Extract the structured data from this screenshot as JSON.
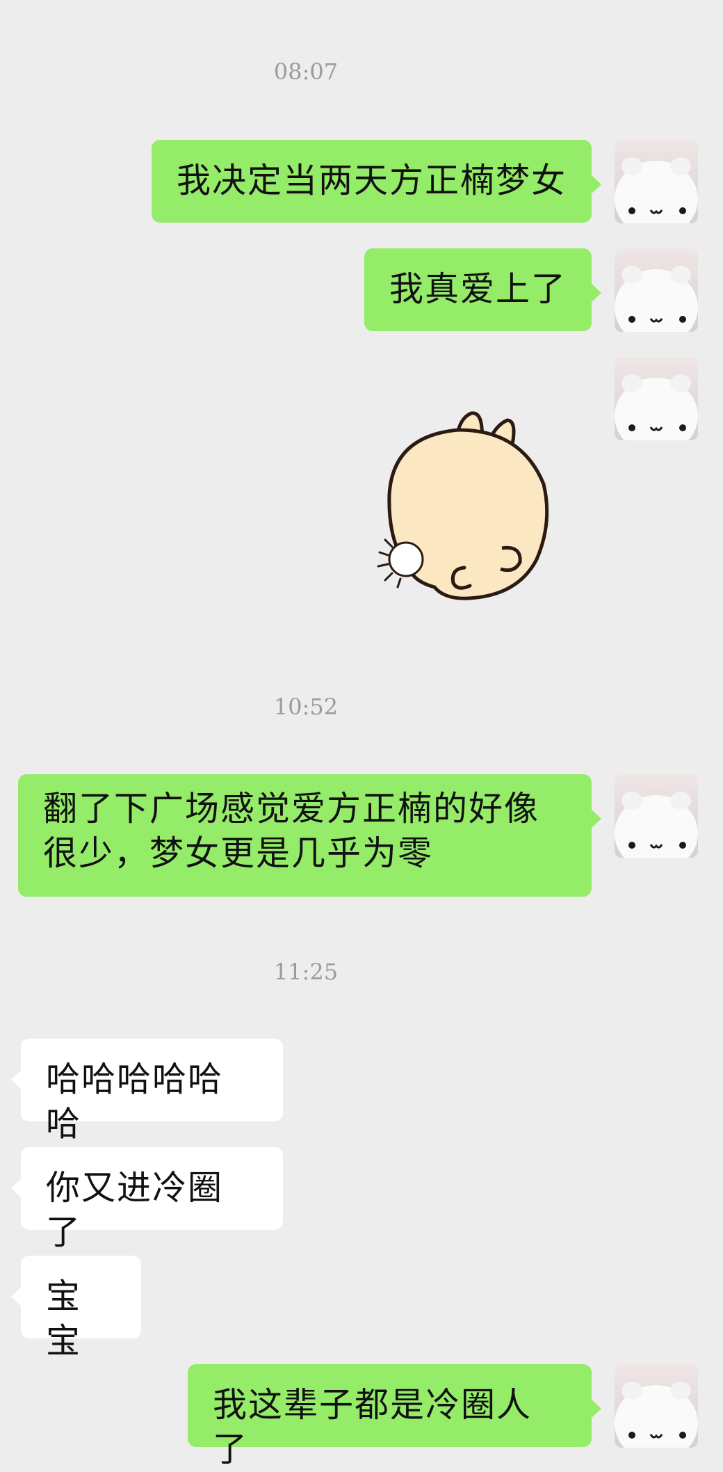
{
  "chat": {
    "timestamps": [
      "08:07",
      "10:52",
      "11:25"
    ],
    "messages": [
      {
        "from": "me",
        "text": "我决定当两天方正楠梦女"
      },
      {
        "from": "me",
        "text": "我真爱上了"
      },
      {
        "from": "me",
        "type": "sticker",
        "sticker": "bunny-sticker"
      },
      {
        "from": "me",
        "text": "翻了下广场感觉爱方正楠的好像很少，梦女更是几乎为零"
      },
      {
        "from": "other",
        "text": "哈哈哈哈哈哈"
      },
      {
        "from": "other",
        "text": "你又进冷圈了"
      },
      {
        "from": "other",
        "text": "宝宝"
      },
      {
        "from": "me",
        "text": "我这辈子都是冷圈人了"
      }
    ]
  },
  "colors": {
    "background": "#ededed",
    "my_bubble": "#95ec69",
    "other_bubble": "#ffffff",
    "timestamp": "#9b9b9b"
  },
  "icons": {
    "avatar": "white-bear-avatar-icon",
    "sticker": "bunny-sticker"
  }
}
